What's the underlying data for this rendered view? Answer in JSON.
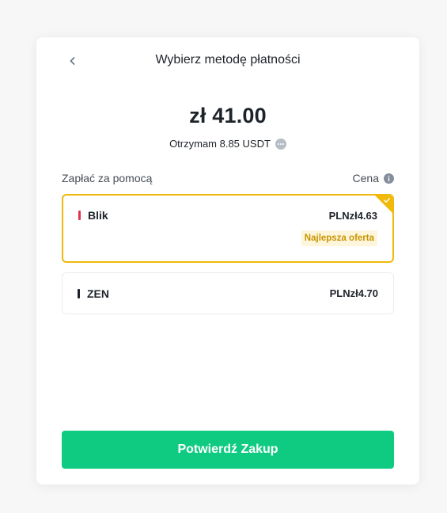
{
  "header": {
    "title": "Wybierz metodę płatności"
  },
  "summary": {
    "amount": "zł 41.00",
    "receive_text": "Otrzymam 8.85 USDT"
  },
  "section": {
    "pay_with_label": "Zapłać za pomocą",
    "price_label": "Cena"
  },
  "options": [
    {
      "name": "Blik",
      "price": "PLNzł4.63",
      "badge": "Najlepsza oferta",
      "selected": true,
      "bar_color": "#e0334a"
    },
    {
      "name": "ZEN",
      "price": "PLNzł4.70",
      "selected": false,
      "bar_color": "#1e2329"
    }
  ],
  "footer": {
    "confirm_label": "Potwierdź Zakup"
  },
  "colors": {
    "accent": "#f0b90b",
    "confirm": "#0ecb81"
  },
  "icons": {
    "back": "chevron-left-icon",
    "more": "more-dots-icon",
    "info": "info-icon",
    "check": "check-icon"
  }
}
